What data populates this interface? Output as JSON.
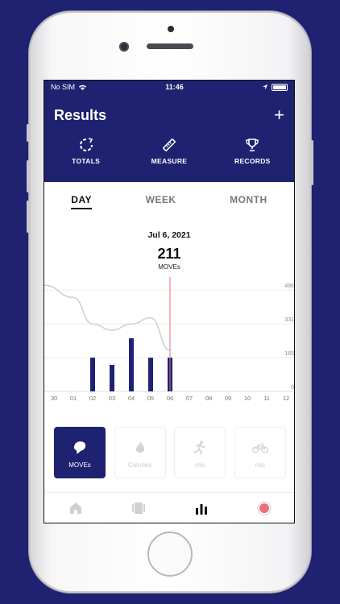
{
  "status_bar": {
    "carrier": "No SIM",
    "time": "11:46"
  },
  "header": {
    "title": "Results",
    "add_label": "+"
  },
  "top_tabs": [
    {
      "label": "TOTALS",
      "icon": "refresh-circle-icon"
    },
    {
      "label": "MEASURE",
      "icon": "ruler-icon"
    },
    {
      "label": "RECORDS",
      "icon": "trophy-icon"
    }
  ],
  "period_tabs": [
    {
      "label": "DAY",
      "active": true
    },
    {
      "label": "WEEK",
      "active": false
    },
    {
      "label": "MONTH",
      "active": false
    }
  ],
  "summary": {
    "date": "Jul 6, 2021",
    "value": "211",
    "unit": "MOVEs"
  },
  "chart_data": {
    "type": "bar",
    "categories": [
      "30",
      "01",
      "02",
      "03",
      "04",
      "05",
      "06",
      "07",
      "08",
      "09",
      "10",
      "11",
      "12"
    ],
    "values": [
      0,
      0,
      165,
      130,
      260,
      165,
      165,
      0,
      0,
      0,
      0,
      0,
      0
    ],
    "yticks": [
      "496",
      "331",
      "165",
      "0"
    ],
    "ytick_values": [
      496,
      331,
      165,
      0
    ],
    "ylim": [
      0,
      560
    ],
    "selected_category": "06",
    "trend_line": [
      520,
      460,
      330,
      300,
      330,
      360,
      200
    ],
    "colors": {
      "bar": "#1f2270",
      "trend": "#c8d6d3",
      "selected": "#e8707a"
    }
  },
  "cards": [
    {
      "label": "MOVEs",
      "icon": "moves-blob-icon",
      "active": true
    },
    {
      "label": "Calories",
      "icon": "flame-icon",
      "active": false
    },
    {
      "label": "mls",
      "icon": "runner-icon",
      "active": false
    },
    {
      "label": "mls",
      "icon": "bicycle-icon",
      "active": false
    }
  ],
  "bottom_nav": [
    {
      "icon": "home-icon"
    },
    {
      "icon": "cards-icon"
    },
    {
      "icon": "bar-chart-icon"
    },
    {
      "icon": "record-icon"
    }
  ],
  "colors": {
    "brand": "#1f2270",
    "accent": "#e8707a"
  }
}
